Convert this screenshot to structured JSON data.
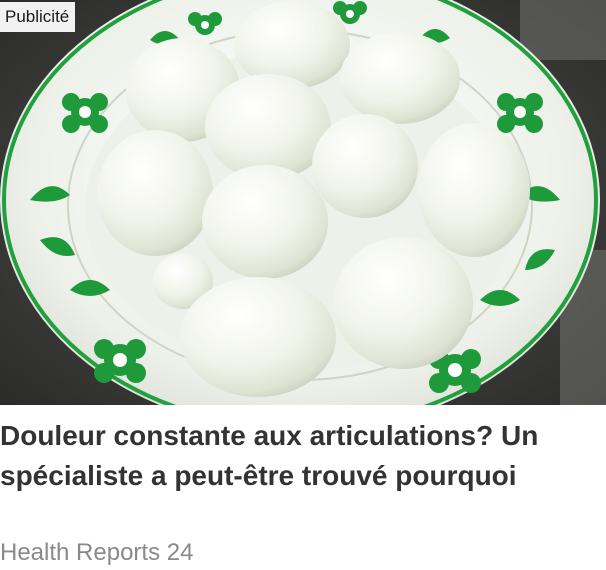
{
  "ad": {
    "badge": "Publicité",
    "title": "Douleur constante aux articulations? Un spécialiste a peut-être trouvé pourquoi",
    "source": "Health Reports 24",
    "image": {
      "subject": "boiled-peeled-eggs-on-floral-plate",
      "colors": {
        "plate": "#f4f6f0",
        "floral_pattern": "#1f9a3a",
        "egg": "#f3f5ec",
        "background": "#3a3a38"
      }
    }
  }
}
